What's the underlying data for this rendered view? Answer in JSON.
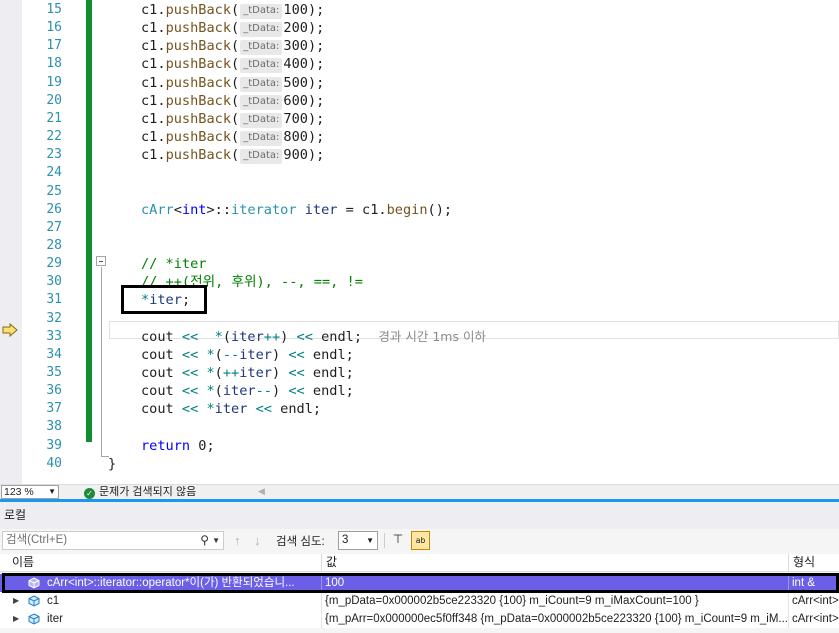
{
  "editor": {
    "lines": [
      {
        "n": "15",
        "html": "c1.<span class=\"method\">pushBack</span>(<span class=\"hint\">_tData:</span>100);"
      },
      {
        "n": "16",
        "html": "c1.<span class=\"method\">pushBack</span>(<span class=\"hint\">_tData:</span>200);"
      },
      {
        "n": "17",
        "html": "c1.<span class=\"method\">pushBack</span>(<span class=\"hint\">_tData:</span>300);"
      },
      {
        "n": "18",
        "html": "c1.<span class=\"method\">pushBack</span>(<span class=\"hint\">_tData:</span>400);"
      },
      {
        "n": "19",
        "html": "c1.<span class=\"method\">pushBack</span>(<span class=\"hint\">_tData:</span>500);"
      },
      {
        "n": "20",
        "html": "c1.<span class=\"method\">pushBack</span>(<span class=\"hint\">_tData:</span>600);"
      },
      {
        "n": "21",
        "html": "c1.<span class=\"method\">pushBack</span>(<span class=\"hint\">_tData:</span>700);"
      },
      {
        "n": "22",
        "html": "c1.<span class=\"method\">pushBack</span>(<span class=\"hint\">_tData:</span>800);"
      },
      {
        "n": "23",
        "html": "c1.<span class=\"method\">pushBack</span>(<span class=\"hint\">_tData:</span>900);"
      },
      {
        "n": "24",
        "html": ""
      },
      {
        "n": "25",
        "html": ""
      },
      {
        "n": "26",
        "html": "<span class=\"type\">cArr</span>&lt;<span class=\"kw\">int</span>&gt;::<span class=\"type\">iterator</span> <span class=\"ident\">iter</span> = c1.<span class=\"method\">begin</span>();"
      },
      {
        "n": "27",
        "html": ""
      },
      {
        "n": "28",
        "html": ""
      },
      {
        "n": "29",
        "html": "<span class=\"cmt\">// *iter</span>"
      },
      {
        "n": "30",
        "html": "<span class=\"cmt\">// ++(전위, 후위), --, ==, !=</span>"
      },
      {
        "n": "31",
        "html": "<span class=\"op\">*</span><span class=\"ident\">iter</span>;"
      },
      {
        "n": "32",
        "html": ""
      },
      {
        "n": "33",
        "html": "cout <span class=\"op\">&lt;&lt;</span>  <span class=\"op\">*</span>(<span class=\"ident\">iter</span><span class=\"op\">++</span>) <span class=\"op\">&lt;&lt;</span> endl;  <span class=\"perf-tip\">경과 시간 1ms 이하</span>"
      },
      {
        "n": "34",
        "html": "cout <span class=\"op\">&lt;&lt;</span> <span class=\"op\">*</span>(<span class=\"op\">--</span><span class=\"ident\">iter</span>) <span class=\"op\">&lt;&lt;</span> endl;"
      },
      {
        "n": "35",
        "html": "cout <span class=\"op\">&lt;&lt;</span> <span class=\"op\">*</span>(<span class=\"op\">++</span><span class=\"ident\">iter</span>) <span class=\"op\">&lt;&lt;</span> endl;"
      },
      {
        "n": "36",
        "html": "cout <span class=\"op\">&lt;&lt;</span> <span class=\"op\">*</span>(<span class=\"ident\">iter</span><span class=\"op\">--</span>) <span class=\"op\">&lt;&lt;</span> endl;"
      },
      {
        "n": "37",
        "html": "cout <span class=\"op\">&lt;&lt;</span> <span class=\"op\">*</span><span class=\"ident\">iter</span> <span class=\"op\">&lt;&lt;</span> endl;"
      },
      {
        "n": "38",
        "html": ""
      },
      {
        "n": "39",
        "html": "<span class=\"kw\">return</span> 0;"
      },
      {
        "n": "40",
        "html": "}"
      }
    ]
  },
  "status": {
    "zoom": "123 %",
    "issues": "문제가 검색되지 않음"
  },
  "locals": {
    "title": "로컬",
    "search_placeholder": "검색(Ctrl+E)",
    "depth_label": "검색 심도:",
    "depth_value": "3",
    "columns": {
      "name": "이름",
      "value": "값",
      "type": "형식"
    },
    "rows": [
      {
        "name": "cArr<int>::iterator::operator*이(가) 반환되었습니...",
        "value": "100",
        "type": "int &",
        "expandable": false,
        "selected": true
      },
      {
        "name": "c1",
        "value": "{m_pData=0x000002b5ce223320 {100} m_iCount=9 m_iMaxCount=100 }",
        "type": "cArr<int>",
        "expandable": true,
        "selected": false
      },
      {
        "name": "iter",
        "value": "{m_pArr=0x000000ec5f0ff348 {m_pData=0x000002b5ce223320 {100} m_iCount=9 m_iM...",
        "type": "cArr<int>",
        "expandable": true,
        "selected": false
      }
    ]
  },
  "colors": {
    "accent": "#1c97ea",
    "change_bar": "#108d2e",
    "selection": "#6b5fe8"
  }
}
